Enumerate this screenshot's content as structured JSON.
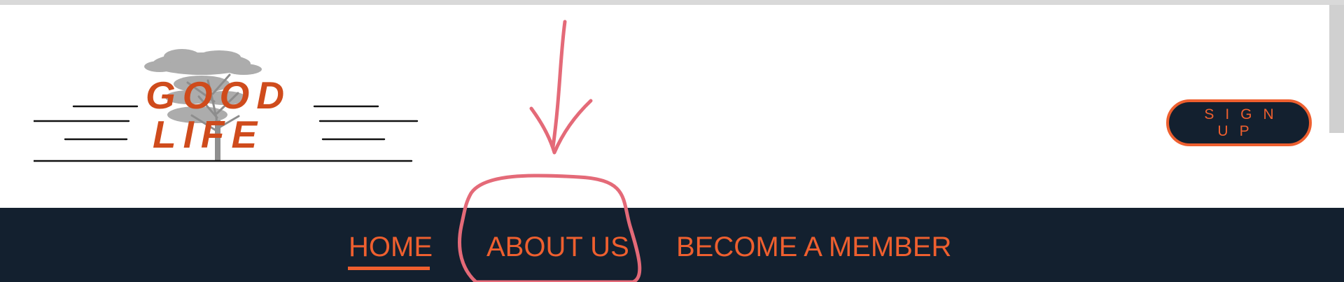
{
  "logo": {
    "line1": "GOOD",
    "line2": "LIFE",
    "icon": "tree-icon"
  },
  "header": {
    "signup_label": "SIGN UP"
  },
  "nav": {
    "items": [
      {
        "label": "HOME",
        "active": true
      },
      {
        "label": "ABOUT US",
        "active": false
      },
      {
        "label": "BECOME A MEMBER",
        "active": false
      }
    ]
  },
  "annotation": {
    "arrow": "arrow-down-icon",
    "circle": "circle-highlight"
  },
  "colors": {
    "accent": "#ee5f2f",
    "navy": "#13202f",
    "logo_orange": "#cf4b1c",
    "annotation_red": "#e46a78"
  }
}
